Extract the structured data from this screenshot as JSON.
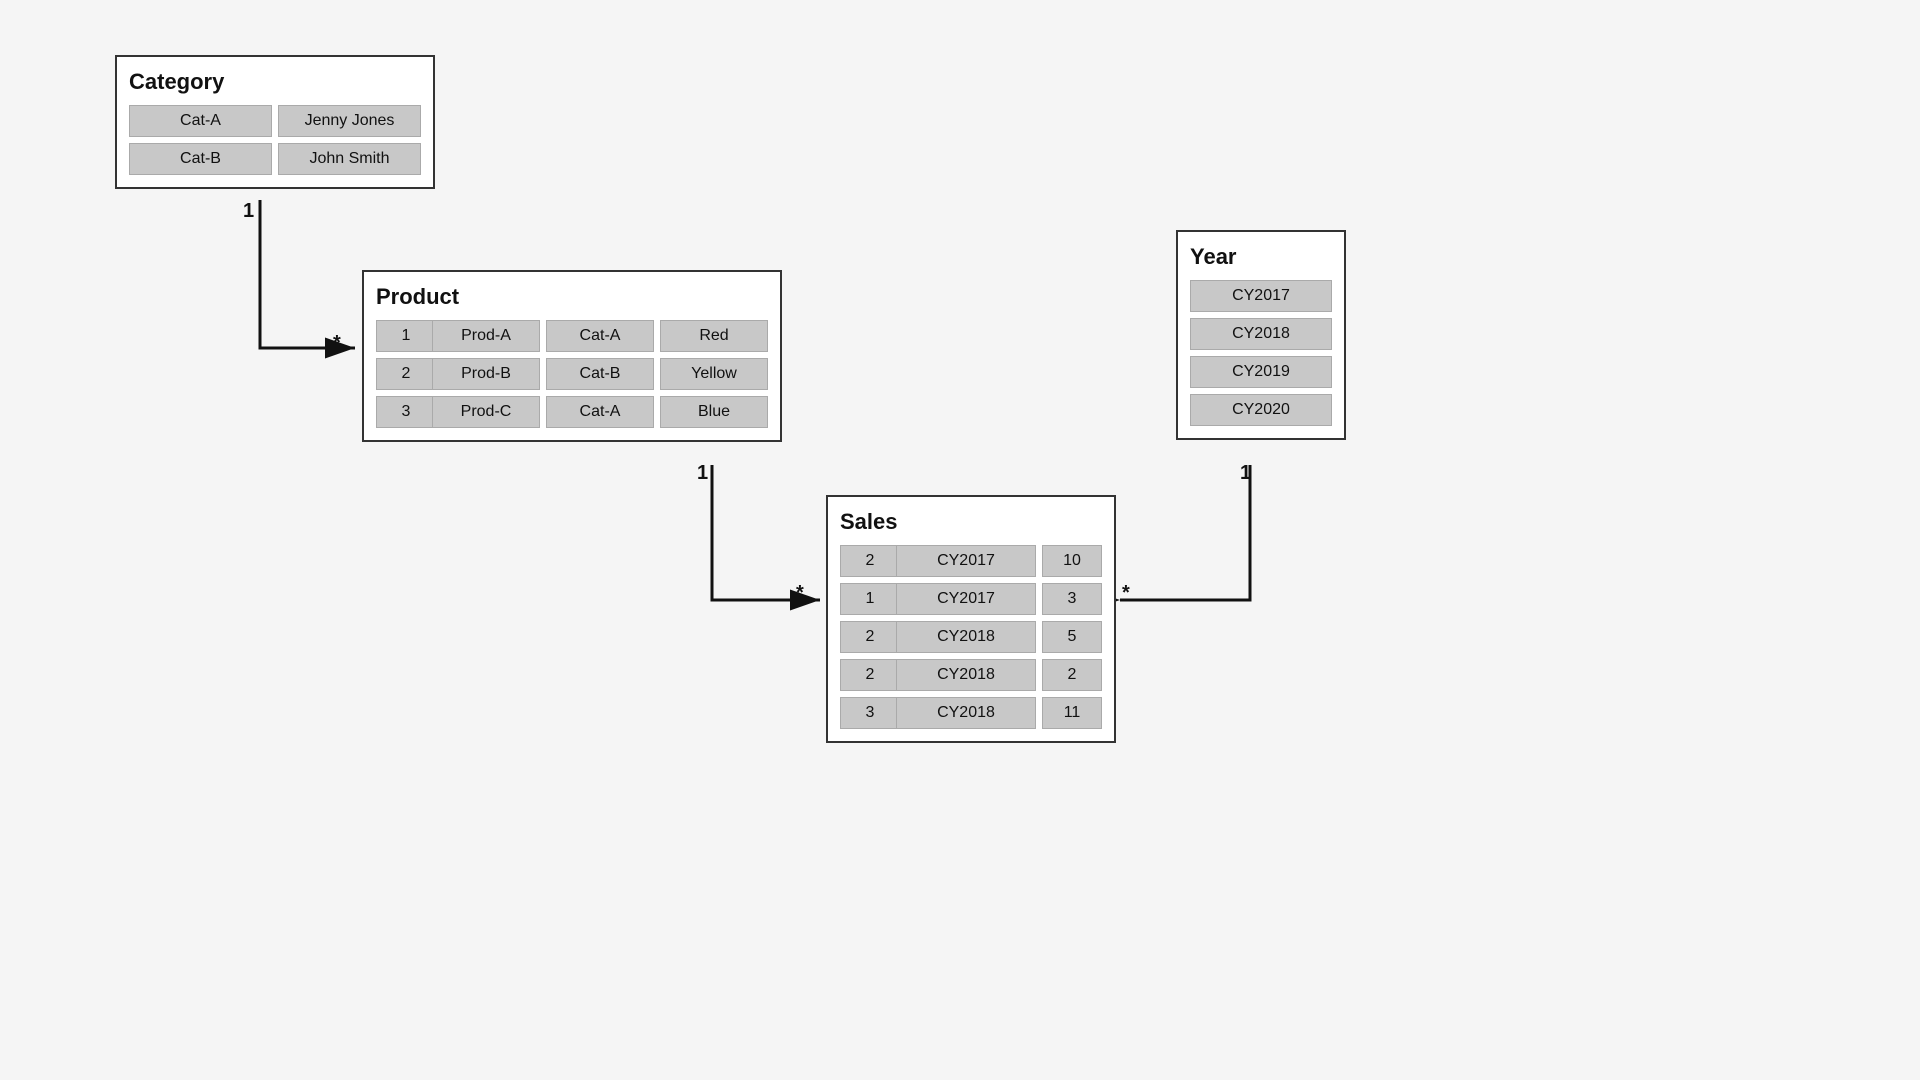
{
  "category": {
    "title": "Category",
    "rows": [
      [
        "Cat-A",
        "Jenny Jones"
      ],
      [
        "Cat-B",
        "John Smith"
      ]
    ]
  },
  "product": {
    "title": "Product",
    "rows": [
      [
        "1",
        "Prod-A",
        "Cat-A",
        "Red"
      ],
      [
        "2",
        "Prod-B",
        "Cat-B",
        "Yellow"
      ],
      [
        "3",
        "Prod-C",
        "Cat-A",
        "Blue"
      ]
    ]
  },
  "year": {
    "title": "Year",
    "rows": [
      [
        "CY2017"
      ],
      [
        "CY2018"
      ],
      [
        "CY2019"
      ],
      [
        "CY2020"
      ]
    ]
  },
  "sales": {
    "title": "Sales",
    "rows": [
      [
        "2",
        "CY2017",
        "10"
      ],
      [
        "1",
        "CY2017",
        "3"
      ],
      [
        "2",
        "CY2018",
        "5"
      ],
      [
        "2",
        "CY2018",
        "2"
      ],
      [
        "3",
        "CY2018",
        "11"
      ]
    ]
  },
  "relations": {
    "cat_to_product": {
      "from_label": "1",
      "to_label": "*"
    },
    "product_to_sales": {
      "from_label": "1",
      "to_label": "*"
    },
    "year_to_sales": {
      "from_label": "1",
      "to_label": "*"
    }
  }
}
